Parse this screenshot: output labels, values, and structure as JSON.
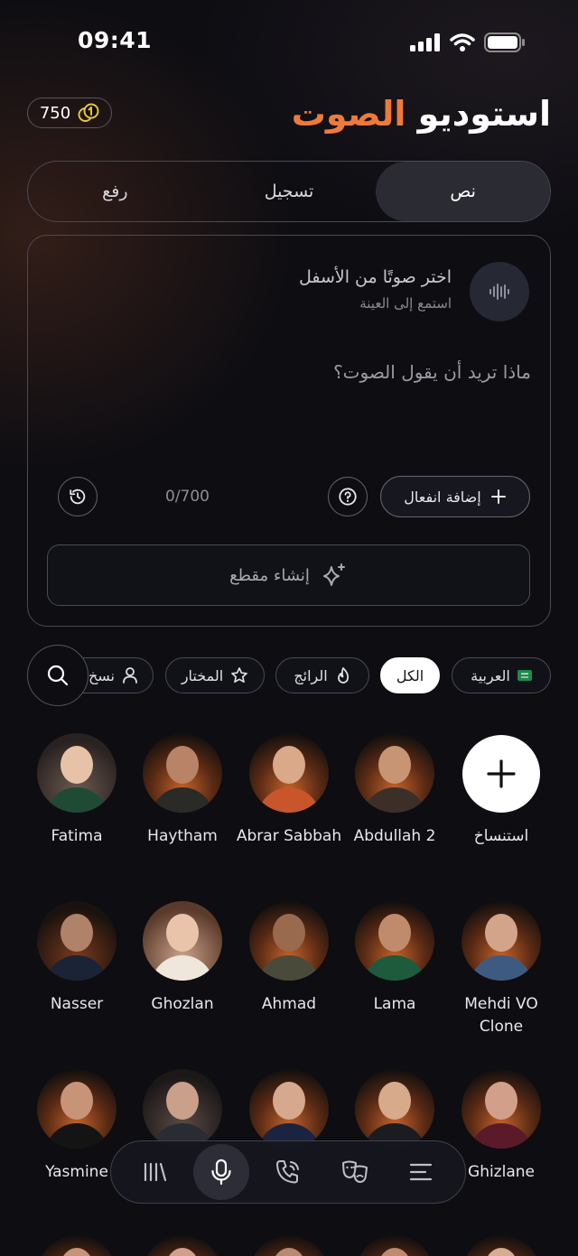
{
  "status_bar": {
    "time": "09:41"
  },
  "header": {
    "title_main": "استوديو",
    "title_accent": "الصوت",
    "credits": "750"
  },
  "tabs": [
    {
      "label": "نص",
      "active": true
    },
    {
      "label": "تسجيل",
      "active": false
    },
    {
      "label": "رفع",
      "active": false
    }
  ],
  "editor": {
    "voice_title": "اختر صوتًا من الأسفل",
    "voice_subtitle": "استمع إلى العينة",
    "prompt_placeholder": "ماذا تريد أن يقول الصوت؟",
    "counter": "0/700",
    "add_emotion_label": "إضافة انفعال",
    "create_label": "إنشاء مقطع"
  },
  "filters": [
    {
      "label": "العربية",
      "icon": "saudi-flag-icon",
      "active": false
    },
    {
      "label": "الكل",
      "icon": "",
      "active": true
    },
    {
      "label": "الرائج",
      "icon": "flame-icon",
      "active": false
    },
    {
      "label": "المختار",
      "icon": "star-icon",
      "active": false
    },
    {
      "label": "نسخ",
      "icon": "user-icon",
      "active": false
    }
  ],
  "clone_label": "استنساخ",
  "voices": [
    {
      "name": "Abdullah 2"
    },
    {
      "name": "Abrar Sabbah"
    },
    {
      "name": "Haytham"
    },
    {
      "name": "Fatima"
    },
    {
      "name": "Mehdi VO Clone"
    },
    {
      "name": "Lama"
    },
    {
      "name": "Ahmad"
    },
    {
      "name": "Ghozlan"
    },
    {
      "name": "Nasser"
    },
    {
      "name": "Ghizlane"
    },
    {
      "name": ""
    },
    {
      "name": ""
    },
    {
      "name": ""
    },
    {
      "name": "Yasmine"
    }
  ],
  "bottom_nav": [
    {
      "icon": "library-icon",
      "active": false
    },
    {
      "icon": "microphone-icon",
      "active": true
    },
    {
      "icon": "phone-icon",
      "active": false
    },
    {
      "icon": "theater-masks-icon",
      "active": false
    },
    {
      "icon": "menu-icon",
      "active": false
    }
  ],
  "colors": {
    "accent": "#ee7a3a",
    "background": "#0d0d12"
  }
}
